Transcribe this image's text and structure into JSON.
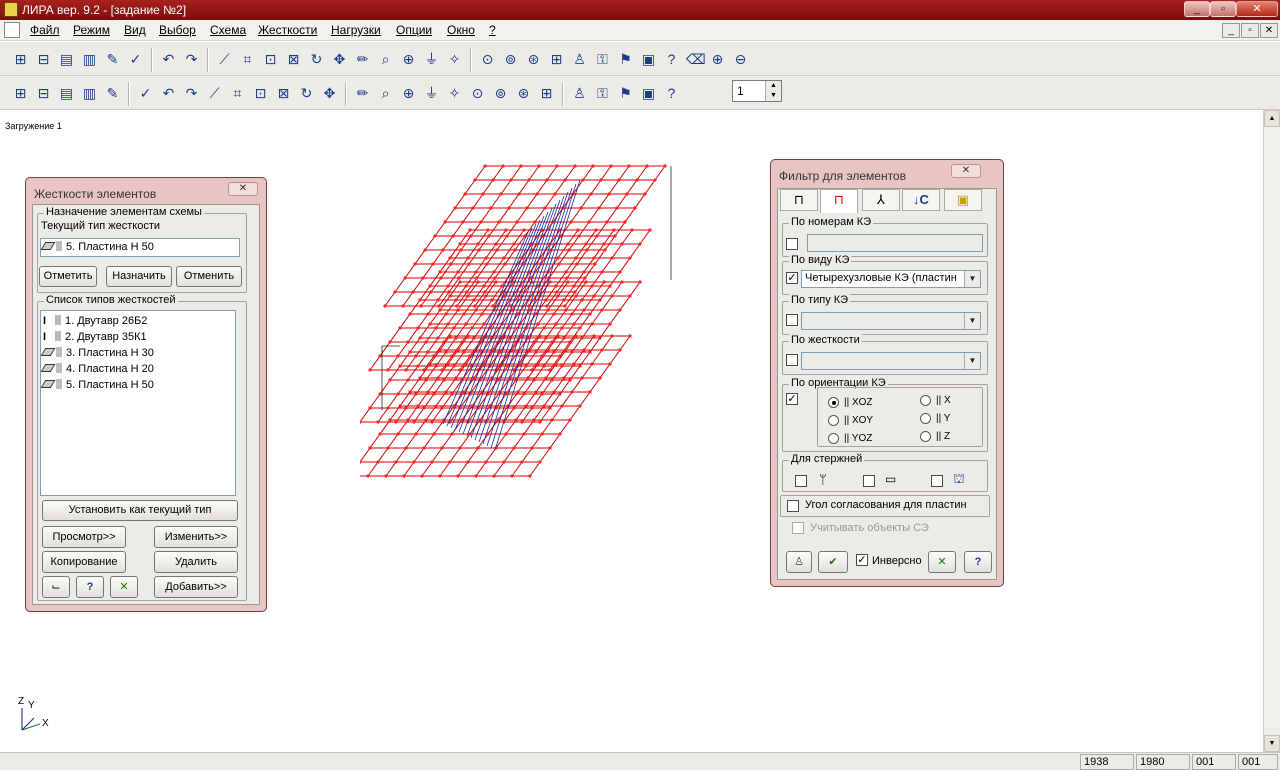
{
  "window": {
    "title": "ЛИРА  вер. 9.2 - [задание №2]",
    "minimize": "_",
    "maximize": "▫",
    "close": "✕"
  },
  "menu": [
    "Файл",
    "Режим",
    "Вид",
    "Выбор",
    "Схема",
    "Жесткости",
    "Нагрузки",
    "Опции",
    "Окно",
    "?"
  ],
  "mdi": {
    "minimize": "_",
    "restore": "▫",
    "close": "✕"
  },
  "toolbar1": [
    "rigid-icon",
    "node-icon",
    "table-icon",
    "list-icon",
    "edit-icon",
    "check-icon",
    "undo-icon",
    "redo-icon",
    "axes-icon",
    "xz-icon",
    "xyz-icon",
    "yz-icon",
    "rotate-icon",
    "move-icon",
    "pencil-icon",
    "zoom-icon",
    "zoom-fit-icon",
    "filter-icon",
    "sparkle-icon",
    "view1-icon",
    "view2-icon",
    "view3-icon",
    "grid-icon",
    "support-icon",
    "lock-icon",
    "tag-icon",
    "book-icon",
    "help-cursor-icon",
    "eraser-icon",
    "zoom-in-icon",
    "zoom-out-icon"
  ],
  "toolbar2": [
    "bar-icon",
    "frame-icon",
    "mesh-icon",
    "cylinder-icon",
    "rotate3d-icon",
    "scissors-icon",
    "cut-icon",
    "triangle-icon",
    "plus-icon",
    "copy-icon",
    "paste-icon",
    "doc-icon",
    "wrench-icon",
    "node-add-icon",
    "wave-icon",
    "tool1-icon",
    "target-icon",
    "merge-icon",
    "split-icon",
    "join-icon",
    "ext-icon",
    "delete-icon",
    "fix-icon",
    "sel1-icon",
    "sel2-icon",
    "sel3-icon",
    "sel4-icon",
    "sel5-icon"
  ],
  "layer_spinner": "1",
  "load_case": "Загружение  1",
  "status": [
    "1938",
    "1980",
    "001",
    "001"
  ],
  "axis": {
    "z": "Z",
    "y": "Y",
    "x": "X"
  },
  "stiffness_dialog": {
    "title": "Жесткости элементов",
    "close": "✕",
    "assign_group": "Назначение элементам схемы",
    "current_type_label": "Текущий тип жесткости",
    "current_type": "5. Пластина  H 50",
    "buttons": {
      "mark": "Отметить",
      "assign": "Назначить",
      "cancel": "Отменить"
    },
    "list_label": "Список типов жесткостей",
    "items": [
      "1. Двутавр 26Б2",
      "2. Двутавр 35К1",
      "3. Пластина  H 30",
      "4. Пластина  H 20",
      "5. Пластина  H 50"
    ],
    "set_current": "Установить как текущий тип",
    "view": "Просмотр>>",
    "change": "Изменить>>",
    "copy": "Копирование",
    "delete": "Удалить",
    "add": "Добавить>>"
  },
  "filter_dialog": {
    "title": "Фильтр для элементов",
    "close": "✕",
    "by_number": "По номерам КЭ",
    "by_kind": "По виду КЭ",
    "kind_value": "Четырехузловые КЭ (пластин",
    "by_type": "По типу КЭ",
    "by_stiffness": "По жесткости",
    "by_orientation": "По ориентации КЭ",
    "orient": {
      "xoz": "|| XOZ",
      "xoy": "|| XOY",
      "yoz": "|| YOZ",
      "x": "|| X",
      "y": "|| Y",
      "z": "|| Z"
    },
    "rods": "Для стержней",
    "angle": "Угол согласования для пластин",
    "consider": "Учитывать объекты СЭ",
    "inverse": "Инверсно"
  },
  "colors": {
    "title": "#8e1814",
    "dialog": "#e8c4c2",
    "mesh": "#d40000",
    "node": "#ff2020",
    "inner": "#1a2a9a"
  }
}
